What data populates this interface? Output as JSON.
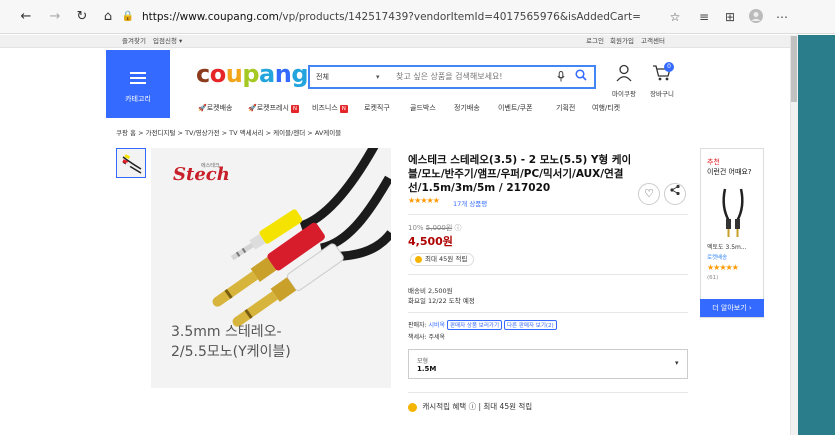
{
  "browser": {
    "url_host": "https://www.coupang.com",
    "url_path": "/vp/products/142517439?vendorItemId=4017565976&isAddedCart="
  },
  "util_bar": {
    "left": [
      "즐겨찾기",
      "입점신청 ▾"
    ],
    "right": [
      "로그인",
      "회원가입",
      "고객센터"
    ]
  },
  "header": {
    "category_label": "카테고리",
    "logo": "coupang",
    "logo_colors": [
      "#8b3a1c",
      "#e52528",
      "#f2a41c",
      "#a5c823",
      "#23a4dd",
      "#346aff",
      "#23a4dd"
    ],
    "search_category": "전체",
    "search_placeholder": "찾고 싶은 상품을 검색해보세요!",
    "mycoupang_label": "마이쿠팡",
    "cart_label": "장바구니",
    "cart_count": "0"
  },
  "gnb": [
    {
      "label": "로켓배송",
      "rocket": true
    },
    {
      "label": "로켓프레시",
      "rocket": true,
      "badge": "N"
    },
    {
      "label": "비즈니스",
      "badge": "N"
    },
    {
      "label": "로켓직구"
    },
    {
      "label": "골드박스"
    },
    {
      "label": "정기배송"
    },
    {
      "label": "이벤트/쿠폰"
    },
    {
      "label": "기획전"
    },
    {
      "label": "여행/티켓"
    }
  ],
  "breadcrumb": "쿠팡 홈  >  가전디지털  >  TV/영상가전  >  TV 액세서리  >  케이블/젠더  >  AV케이블",
  "product": {
    "image_brand": "Stech",
    "image_brand_sub": "에스테크",
    "image_caption_line1": "3.5mm 스테레오-",
    "image_caption_line2": "2/5.5모노(Y케이블)",
    "title": "에스테크 스테레오(3.5) - 2 모노(5.5) Y형 케이블/모노/반주기/앰프/우퍼/PC/믹서기/AUX/연결 선/1.5m/3m/5m / 217020",
    "rating_stars": "★★★★★",
    "review_count": "17개 상품평",
    "discount_rate": "10%",
    "original_price": "5,000원",
    "sale_price": "4,500원",
    "cash_reward": "최대 45원 적립",
    "shipping_fee": "배송비 2,500원",
    "delivery_date": "화요일 12/22 도착 예정",
    "seller_label": "판매자:",
    "seller_name": "시비옥",
    "seller_pill1": "판매자 상품 보러가기",
    "seller_pill2": "다른 판매자 보기(2)",
    "seller_line2": "책세사: 주세옥",
    "option_label": "모형",
    "option_value": "1.5M",
    "benefit_text": "캐시적립 혜택",
    "benefit_sub": "최대 45원 적립"
  },
  "recommend": {
    "title1": "추천",
    "title2": "이런건 어때요?",
    "item_name": "엑토도 3.5m...",
    "item_rocket": "로켓배송",
    "item_stars": "★★★★★",
    "item_count": "(61)",
    "more_button": "더 알아보기 ›"
  }
}
